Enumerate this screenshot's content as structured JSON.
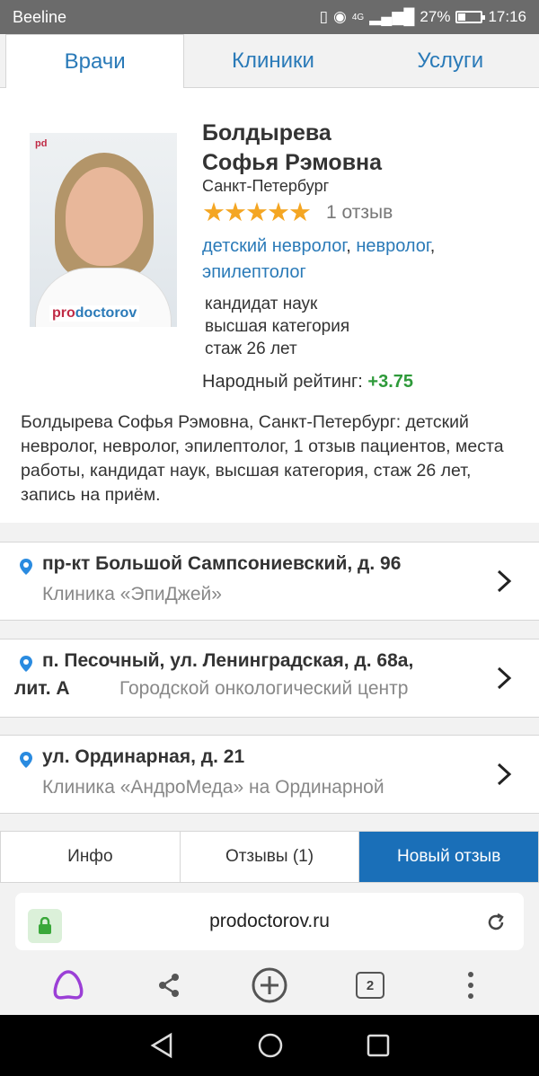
{
  "status_bar": {
    "carrier": "Beeline",
    "network": "4G",
    "battery_percent": "27%",
    "time": "17:16"
  },
  "top_tabs": [
    {
      "label": "Врачи",
      "active": true
    },
    {
      "label": "Клиники",
      "active": false
    },
    {
      "label": "Услуги",
      "active": false
    }
  ],
  "doctor": {
    "photo_brand_left": "pro",
    "photo_brand_right": "doctorov",
    "photo_logo": "pd",
    "name_line1": "Болдырева",
    "name_line2": "Софья Рэмовна",
    "city": "Санкт-Петербург",
    "stars": 5,
    "reviews": "1 отзыв",
    "specialties": [
      "детский невролог",
      "невролог",
      "эпилептолог"
    ],
    "degree": "кандидат наук",
    "category": "высшая категория",
    "experience": "стаж 26 лет",
    "rating_label": "Народный рейтинг:",
    "rating_value": "+3.75",
    "description": "Болдырева Софья Рэмовна, Санкт-Петербург: детский невролог, невролог, эпилептолог, 1 отзыв пациентов, места работы, кандидат наук, высшая категория, стаж 26 лет, запись на приём."
  },
  "addresses": [
    {
      "street": "пр-кт Большой Сампсониевский, д. 96",
      "clinic": "Клиника «ЭпиДжей»"
    },
    {
      "street": "п. Песочный, ул. Ленинградская, д. 68а,",
      "street_cont": "лит. А",
      "clinic": "Городской онкологический центр"
    },
    {
      "street": "ул. Ординарная, д. 21",
      "clinic": "Клиника «АндроМеда» на Ординарной"
    }
  ],
  "bottom_tabs": {
    "info": "Инфо",
    "reviews": "Отзывы (1)",
    "new_review": "Новый отзыв"
  },
  "browser": {
    "url": "prodoctorov.ru",
    "tab_count": "2"
  },
  "colors": {
    "link": "#2a7ab8",
    "star": "#f4a623",
    "rating": "#2e9a3a",
    "primary_button": "#1a6fb8"
  }
}
